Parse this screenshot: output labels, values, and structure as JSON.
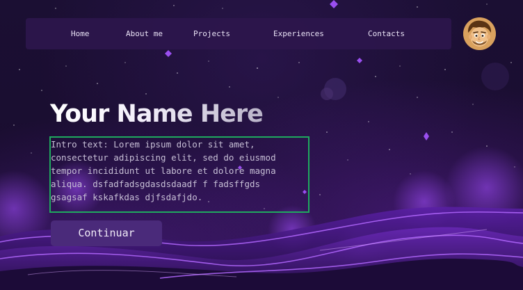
{
  "nav": {
    "items": [
      {
        "label": "Home"
      },
      {
        "label": "About me"
      },
      {
        "label": "Projects"
      },
      {
        "label": "Experiences"
      },
      {
        "label": "Contacts"
      }
    ]
  },
  "hero": {
    "title": "Your Name Here",
    "intro": "Intro text: Lorem ipsum dolor sit amet,\nconsectetur adipiscing elit, sed do eiusmod\ntempor incididunt ut labore et dolore magna\naliqua. dsfadfadsgdasdsdaadf f fadsffgds\ngsagsaf kskafkdas djfsdafjdo.",
    "cta_label": "Continuar"
  },
  "colors": {
    "background": "#1a0d30",
    "navbar": "#2c164c",
    "button": "#4a2a7a",
    "highlight_border": "#1faa5f",
    "accent": "#8a3df0"
  },
  "icons": {
    "avatar": "cartoon-avatar-icon"
  }
}
